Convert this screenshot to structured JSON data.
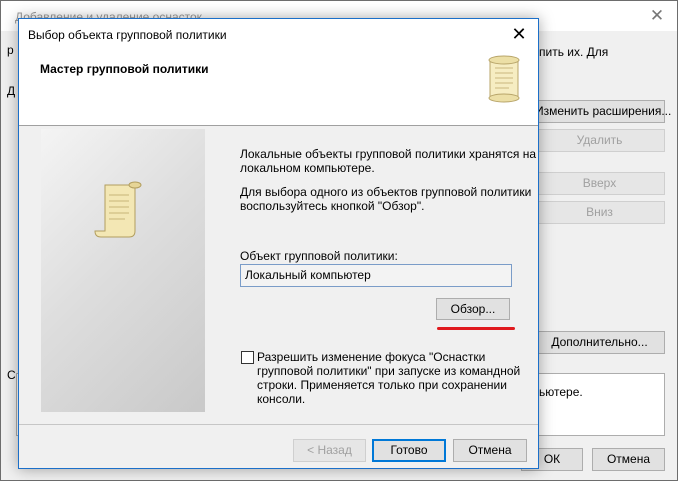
{
  "background_window": {
    "title": "Добавление и удаление оснасток",
    "close_glyph": "✕",
    "partial_text_top": "пить их. Для",
    "left_edge_letters": [
      "р",
      "Д",
      "С"
    ],
    "buttons": {
      "change_extensions": "Изменить расширения...",
      "remove": "Удалить",
      "up": "Вверх",
      "down": "Вниз",
      "advanced": "Дополнительно...",
      "ok": "ОК",
      "cancel": "Отмена"
    },
    "description_partial": "ьютере."
  },
  "dialog": {
    "title": "Выбор объекта групповой политики",
    "close_glyph": "✕",
    "heading": "Мастер групповой политики",
    "intro_lines": [
      "Локальные объекты групповой политики хранятся на",
      "локальном компьютере."
    ],
    "browse_hint_lines": [
      "Для выбора одного из объектов групповой политики",
      "воспользуйтесь кнопкой \"Обзор\"."
    ],
    "gpo_label": "Объект групповой политики:",
    "gpo_value": "Локальный компьютер",
    "browse_button": "Обзор...",
    "checkbox_checked": false,
    "checkbox_lines": [
      "Разрешить изменение фокуса \"Оснастки",
      "групповой политики\" при запуске из командной",
      "строки. Применяется только при сохранении",
      "консоли."
    ],
    "buttons": {
      "back": "< Назад",
      "finish": "Готово",
      "cancel": "Отмена"
    }
  },
  "colors": {
    "accent": "#0078d7",
    "highlight_underline": "#e0191e"
  },
  "icons": {
    "header": "scroll-icon",
    "side_panel": "scroll-icon"
  }
}
